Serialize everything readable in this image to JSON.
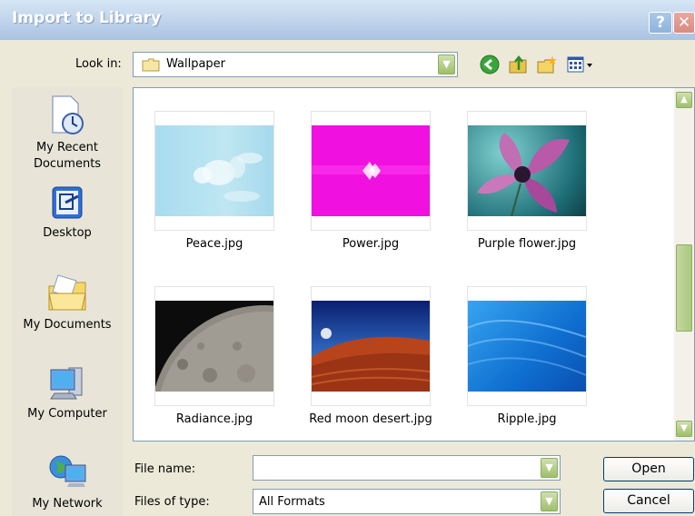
{
  "window": {
    "title": "Import to Library",
    "help_glyph": "?",
    "close_glyph": "✕"
  },
  "lookin": {
    "label": "Look in:",
    "value": "Wallpaper"
  },
  "toolbar": {
    "icons": [
      "back-icon",
      "up-folder-icon",
      "new-folder-icon",
      "views-menu-icon"
    ]
  },
  "places": [
    {
      "label_line1": "My Recent",
      "label_line2": "Documents",
      "icon": "recent-documents-icon"
    },
    {
      "label_line1": "Desktop",
      "label_line2": "",
      "icon": "desktop-icon"
    },
    {
      "label_line1": "My Documents",
      "label_line2": "",
      "icon": "my-documents-icon"
    },
    {
      "label_line1": "My Computer",
      "label_line2": "",
      "icon": "my-computer-icon"
    },
    {
      "label_line1": "My Network",
      "label_line2": "",
      "icon": "my-network-icon"
    }
  ],
  "files": [
    {
      "name": "Peace.jpg"
    },
    {
      "name": "Power.jpg"
    },
    {
      "name": "Purple flower.jpg"
    },
    {
      "name": "Radiance.jpg"
    },
    {
      "name": "Red moon desert.jpg"
    },
    {
      "name": "Ripple.jpg"
    }
  ],
  "filename": {
    "label": "File name:",
    "value": ""
  },
  "filetype": {
    "label": "Files of type:",
    "value": "All Formats"
  },
  "buttons": {
    "open": "Open",
    "cancel": "Cancel"
  }
}
